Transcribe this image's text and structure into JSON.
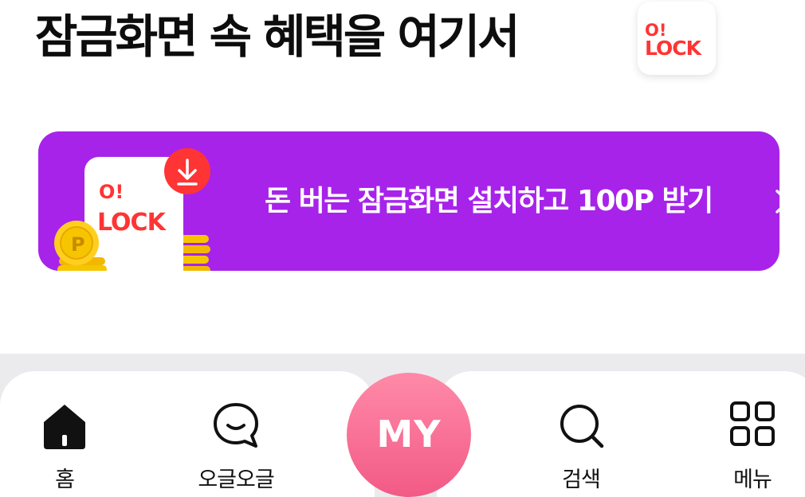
{
  "header": {
    "title": "잠금화면 속 혜택을 여기서",
    "logo_text_top": "O!",
    "logo_text_bottom": "LOCK"
  },
  "banner": {
    "text": "돈 버는 잠금화면 설치하고 100P 받기",
    "art_logo_top": "O!",
    "art_logo_bottom": "LOCK",
    "coin_letter": "P",
    "arrow_icon": "chevron-right-icon",
    "download_icon": "download-icon"
  },
  "bottom_nav": {
    "items": [
      {
        "label": "홈",
        "icon": "home-icon"
      },
      {
        "label": "오글오글",
        "icon": "chat-bubble-icon"
      },
      {
        "label": "MY",
        "icon": "my-button"
      },
      {
        "label": "검색",
        "icon": "search-icon"
      },
      {
        "label": "메뉴",
        "icon": "menu-grid-icon"
      }
    ]
  },
  "colors": {
    "banner_bg": "#a723ea",
    "brand_red": "#ff3434",
    "my_gradient_top": "#ff8aa8",
    "my_gradient_bottom": "#f25a86",
    "nav_band": "#ebebee",
    "coin_gold": "#f7c500"
  }
}
